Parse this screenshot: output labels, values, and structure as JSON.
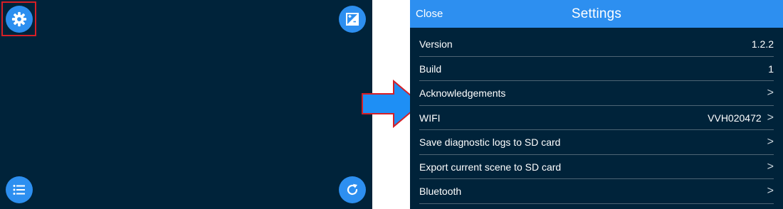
{
  "left_screen": {
    "settings_button_icon": "gear-icon",
    "image_button_icon": "image-icon",
    "list_button_icon": "list-icon",
    "refresh_button_icon": "refresh-icon"
  },
  "colors": {
    "background": "#00233a",
    "accent": "#2d8ff0",
    "highlight": "#d61f26",
    "divider": "#4d6474"
  },
  "settings": {
    "nav": {
      "close_label": "Close",
      "title": "Settings"
    },
    "rows": [
      {
        "label": "Version",
        "value": "1.2.2",
        "chevron": false
      },
      {
        "label": "Build",
        "value": "1",
        "chevron": false
      },
      {
        "label": "Acknowledgements",
        "value": "",
        "chevron": true
      },
      {
        "label": "WIFI",
        "value": "VVH020472",
        "chevron": true
      },
      {
        "label": "Save diagnostic logs to SD card",
        "value": "",
        "chevron": true
      },
      {
        "label": "Export current scene to SD card",
        "value": "",
        "chevron": true
      },
      {
        "label": "Bluetooth",
        "value": "",
        "chevron": true
      }
    ]
  }
}
